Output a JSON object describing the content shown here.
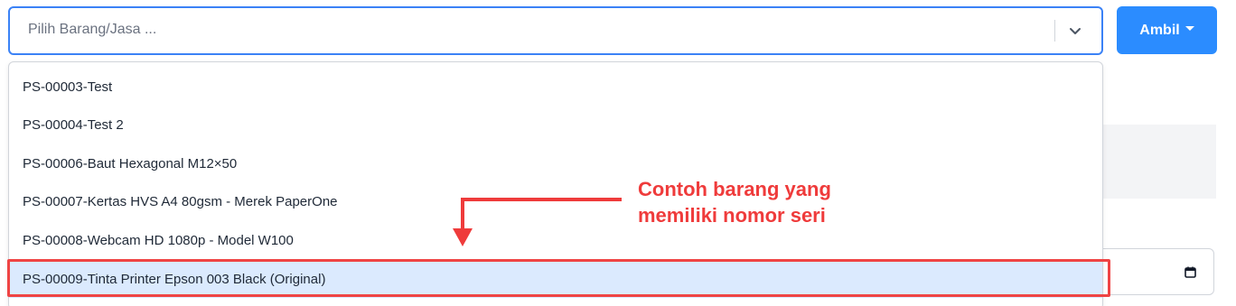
{
  "select": {
    "placeholder": "Pilih Barang/Jasa ...",
    "chevron_icon": "chevron-down-icon"
  },
  "toolbar": {
    "ambil_label": "Ambil",
    "button_color": "#2b8cff"
  },
  "background": {
    "header_fragment": "n",
    "calendar_icon": "calendar-icon"
  },
  "dropdown": {
    "items": [
      {
        "label": "PS-00003-Test",
        "selected": false
      },
      {
        "label": "PS-00004-Test 2",
        "selected": false
      },
      {
        "label": "PS-00006-Baut Hexagonal M12×50",
        "selected": false
      },
      {
        "label": "PS-00007-Kertas HVS A4 80gsm - Merek PaperOne",
        "selected": false
      },
      {
        "label": "PS-00008-Webcam HD 1080p - Model W100",
        "selected": false
      },
      {
        "label": "PS-00009-Tinta Printer Epson 003 Black (Original)",
        "selected": true
      }
    ]
  },
  "annotation": {
    "line1": "Contoh barang yang",
    "line2": "memiliki nomor seri",
    "color": "#ef3b3b"
  }
}
